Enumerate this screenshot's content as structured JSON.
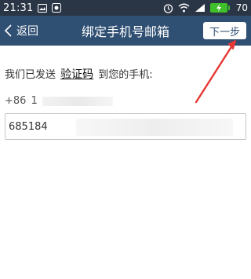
{
  "status_bar": {
    "time": "21:31",
    "battery_level": "70",
    "icons": [
      "image-icon",
      "app-icon",
      "alarm-icon",
      "wifi-icon",
      "signal-icon",
      "battery-icon"
    ]
  },
  "nav": {
    "back_label": "返回",
    "title": "绑定手机号邮箱",
    "next_label": "下一步"
  },
  "content": {
    "sent_prefix": "我们已发送",
    "code_link": "验证码",
    "sent_suffix": "到您的手机:",
    "country_code": "+86",
    "phone_visible": "1",
    "code_value": "685184"
  },
  "colors": {
    "status_bar_bg": "#2a3546",
    "nav_bg": "#2f4f73",
    "battery": "#3fbf2a",
    "annotation_arrow": "#e53935"
  }
}
